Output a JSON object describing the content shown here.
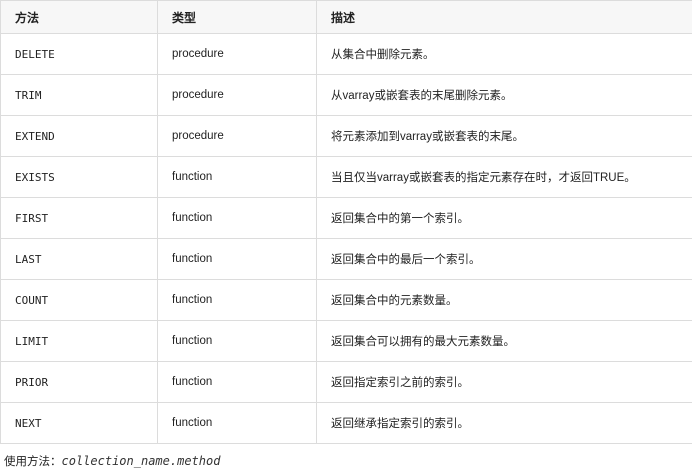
{
  "table": {
    "headers": [
      "方法",
      "类型",
      "描述"
    ],
    "rows": [
      {
        "method": "DELETE",
        "type": "procedure",
        "description": "从集合中删除元素。"
      },
      {
        "method": "TRIM",
        "type": "procedure",
        "description": "从varray或嵌套表的末尾删除元素。"
      },
      {
        "method": "EXTEND",
        "type": "procedure",
        "description": "将元素添加到varray或嵌套表的末尾。"
      },
      {
        "method": "EXISTS",
        "type": "function",
        "description": "当且仅当varray或嵌套表的指定元素存在时，才返回TRUE。"
      },
      {
        "method": "FIRST",
        "type": "function",
        "description": "返回集合中的第一个索引。"
      },
      {
        "method": "LAST",
        "type": "function",
        "description": "返回集合中的最后一个索引。"
      },
      {
        "method": "COUNT",
        "type": "function",
        "description": "返回集合中的元素数量。"
      },
      {
        "method": "LIMIT",
        "type": "function",
        "description": "返回集合可以拥有的最大元素数量。"
      },
      {
        "method": "PRIOR",
        "type": "function",
        "description": "返回指定索引之前的索引。"
      },
      {
        "method": "NEXT",
        "type": "function",
        "description": "返回继承指定索引的索引。"
      }
    ]
  },
  "usage": {
    "label": "使用方法：",
    "code": "collection_name.method"
  }
}
